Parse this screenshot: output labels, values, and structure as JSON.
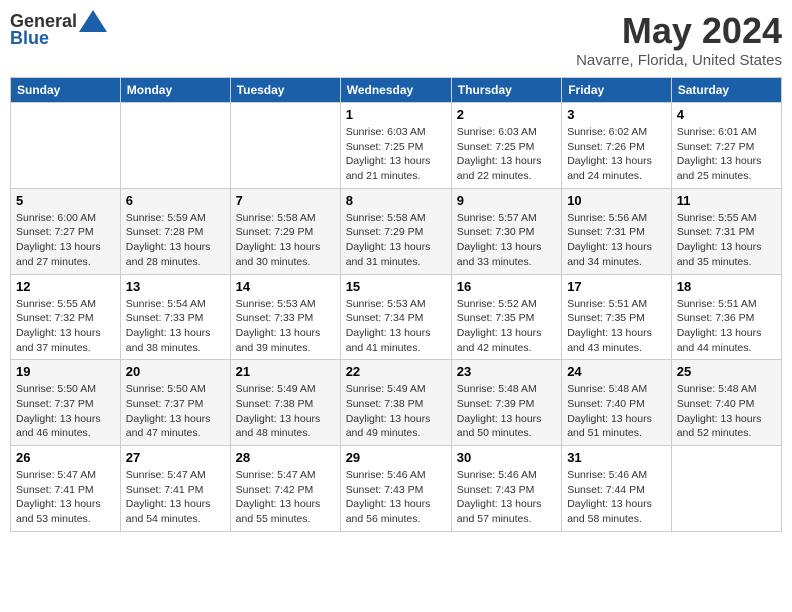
{
  "logo": {
    "general": "General",
    "blue": "Blue"
  },
  "title": "May 2024",
  "subtitle": "Navarre, Florida, United States",
  "days_header": [
    "Sunday",
    "Monday",
    "Tuesday",
    "Wednesday",
    "Thursday",
    "Friday",
    "Saturday"
  ],
  "weeks": [
    {
      "cells": [
        {
          "day": "",
          "info": ""
        },
        {
          "day": "",
          "info": ""
        },
        {
          "day": "",
          "info": ""
        },
        {
          "day": "1",
          "info": "Sunrise: 6:03 AM\nSunset: 7:25 PM\nDaylight: 13 hours\nand 21 minutes."
        },
        {
          "day": "2",
          "info": "Sunrise: 6:03 AM\nSunset: 7:25 PM\nDaylight: 13 hours\nand 22 minutes."
        },
        {
          "day": "3",
          "info": "Sunrise: 6:02 AM\nSunset: 7:26 PM\nDaylight: 13 hours\nand 24 minutes."
        },
        {
          "day": "4",
          "info": "Sunrise: 6:01 AM\nSunset: 7:27 PM\nDaylight: 13 hours\nand 25 minutes."
        }
      ]
    },
    {
      "cells": [
        {
          "day": "5",
          "info": "Sunrise: 6:00 AM\nSunset: 7:27 PM\nDaylight: 13 hours\nand 27 minutes."
        },
        {
          "day": "6",
          "info": "Sunrise: 5:59 AM\nSunset: 7:28 PM\nDaylight: 13 hours\nand 28 minutes."
        },
        {
          "day": "7",
          "info": "Sunrise: 5:58 AM\nSunset: 7:29 PM\nDaylight: 13 hours\nand 30 minutes."
        },
        {
          "day": "8",
          "info": "Sunrise: 5:58 AM\nSunset: 7:29 PM\nDaylight: 13 hours\nand 31 minutes."
        },
        {
          "day": "9",
          "info": "Sunrise: 5:57 AM\nSunset: 7:30 PM\nDaylight: 13 hours\nand 33 minutes."
        },
        {
          "day": "10",
          "info": "Sunrise: 5:56 AM\nSunset: 7:31 PM\nDaylight: 13 hours\nand 34 minutes."
        },
        {
          "day": "11",
          "info": "Sunrise: 5:55 AM\nSunset: 7:31 PM\nDaylight: 13 hours\nand 35 minutes."
        }
      ]
    },
    {
      "cells": [
        {
          "day": "12",
          "info": "Sunrise: 5:55 AM\nSunset: 7:32 PM\nDaylight: 13 hours\nand 37 minutes."
        },
        {
          "day": "13",
          "info": "Sunrise: 5:54 AM\nSunset: 7:33 PM\nDaylight: 13 hours\nand 38 minutes."
        },
        {
          "day": "14",
          "info": "Sunrise: 5:53 AM\nSunset: 7:33 PM\nDaylight: 13 hours\nand 39 minutes."
        },
        {
          "day": "15",
          "info": "Sunrise: 5:53 AM\nSunset: 7:34 PM\nDaylight: 13 hours\nand 41 minutes."
        },
        {
          "day": "16",
          "info": "Sunrise: 5:52 AM\nSunset: 7:35 PM\nDaylight: 13 hours\nand 42 minutes."
        },
        {
          "day": "17",
          "info": "Sunrise: 5:51 AM\nSunset: 7:35 PM\nDaylight: 13 hours\nand 43 minutes."
        },
        {
          "day": "18",
          "info": "Sunrise: 5:51 AM\nSunset: 7:36 PM\nDaylight: 13 hours\nand 44 minutes."
        }
      ]
    },
    {
      "cells": [
        {
          "day": "19",
          "info": "Sunrise: 5:50 AM\nSunset: 7:37 PM\nDaylight: 13 hours\nand 46 minutes."
        },
        {
          "day": "20",
          "info": "Sunrise: 5:50 AM\nSunset: 7:37 PM\nDaylight: 13 hours\nand 47 minutes."
        },
        {
          "day": "21",
          "info": "Sunrise: 5:49 AM\nSunset: 7:38 PM\nDaylight: 13 hours\nand 48 minutes."
        },
        {
          "day": "22",
          "info": "Sunrise: 5:49 AM\nSunset: 7:38 PM\nDaylight: 13 hours\nand 49 minutes."
        },
        {
          "day": "23",
          "info": "Sunrise: 5:48 AM\nSunset: 7:39 PM\nDaylight: 13 hours\nand 50 minutes."
        },
        {
          "day": "24",
          "info": "Sunrise: 5:48 AM\nSunset: 7:40 PM\nDaylight: 13 hours\nand 51 minutes."
        },
        {
          "day": "25",
          "info": "Sunrise: 5:48 AM\nSunset: 7:40 PM\nDaylight: 13 hours\nand 52 minutes."
        }
      ]
    },
    {
      "cells": [
        {
          "day": "26",
          "info": "Sunrise: 5:47 AM\nSunset: 7:41 PM\nDaylight: 13 hours\nand 53 minutes."
        },
        {
          "day": "27",
          "info": "Sunrise: 5:47 AM\nSunset: 7:41 PM\nDaylight: 13 hours\nand 54 minutes."
        },
        {
          "day": "28",
          "info": "Sunrise: 5:47 AM\nSunset: 7:42 PM\nDaylight: 13 hours\nand 55 minutes."
        },
        {
          "day": "29",
          "info": "Sunrise: 5:46 AM\nSunset: 7:43 PM\nDaylight: 13 hours\nand 56 minutes."
        },
        {
          "day": "30",
          "info": "Sunrise: 5:46 AM\nSunset: 7:43 PM\nDaylight: 13 hours\nand 57 minutes."
        },
        {
          "day": "31",
          "info": "Sunrise: 5:46 AM\nSunset: 7:44 PM\nDaylight: 13 hours\nand 58 minutes."
        },
        {
          "day": "",
          "info": ""
        }
      ]
    }
  ]
}
